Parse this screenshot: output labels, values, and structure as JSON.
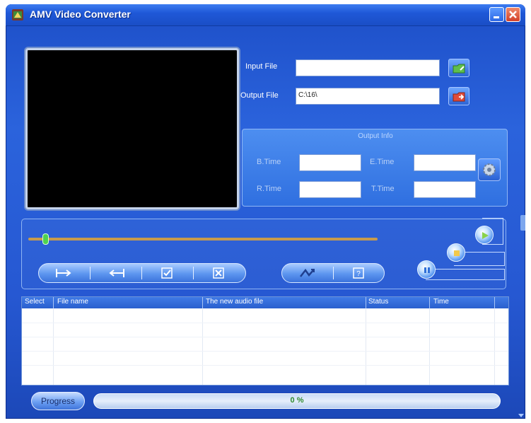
{
  "window": {
    "title": "AMV Video Converter"
  },
  "files": {
    "input_label": "Input File",
    "input_value": "",
    "output_label": "Output File",
    "output_value": "C:\\16\\"
  },
  "output_info": {
    "title": "Output Info",
    "btime_label": "B.Time",
    "etime_label": "E.Time",
    "rtime_label": "R.Time",
    "ttime_label": "T.Time",
    "btime_value": "",
    "etime_value": "",
    "rtime_value": "",
    "ttime_value": ""
  },
  "playback": {
    "seek_fraction": 0.0,
    "buttons": [
      "set-start",
      "set-end",
      "check",
      "clear",
      "convert",
      "help"
    ],
    "round_buttons": [
      "play",
      "stop",
      "pause"
    ]
  },
  "table": {
    "columns": [
      "Select",
      "File name",
      "The new audio file",
      "Status",
      "Time"
    ],
    "rows": []
  },
  "progress": {
    "button_label": "Progress",
    "percent": 0,
    "text": "0 %"
  },
  "colors": {
    "accent": "#2658d2",
    "title_bar": "#1f58d8",
    "seek_track": "#c79b4d",
    "progress_text": "#2f8a2f"
  }
}
